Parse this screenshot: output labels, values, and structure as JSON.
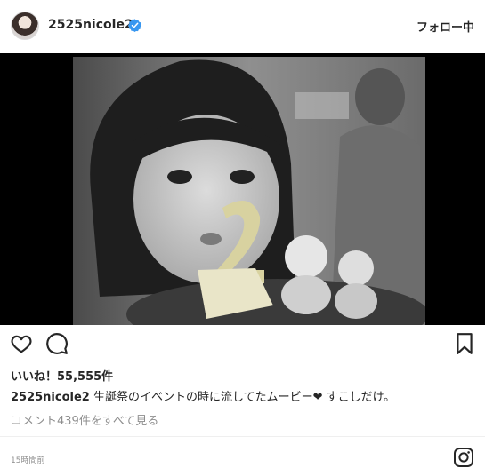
{
  "header": {
    "username": "2525nicole2",
    "follow_label": "フォロー中"
  },
  "post": {
    "likes_text": "いいね！55,555件",
    "caption_user": "2525nicole2",
    "caption_text": " 生誕祭のイベントの時に流してたムービー❤︎ すこしだけ。",
    "comments_link": "コメント439件をすべて見る",
    "timestamp": "15時間前"
  },
  "icons": {
    "verified": "verified-badge-icon",
    "like": "heart-icon",
    "comment": "comment-bubble-icon",
    "save": "bookmark-icon",
    "brand": "instagram-logo-icon"
  },
  "colors": {
    "verified_blue": "#3897f0",
    "text": "#262626",
    "muted": "#8e8e8e"
  }
}
